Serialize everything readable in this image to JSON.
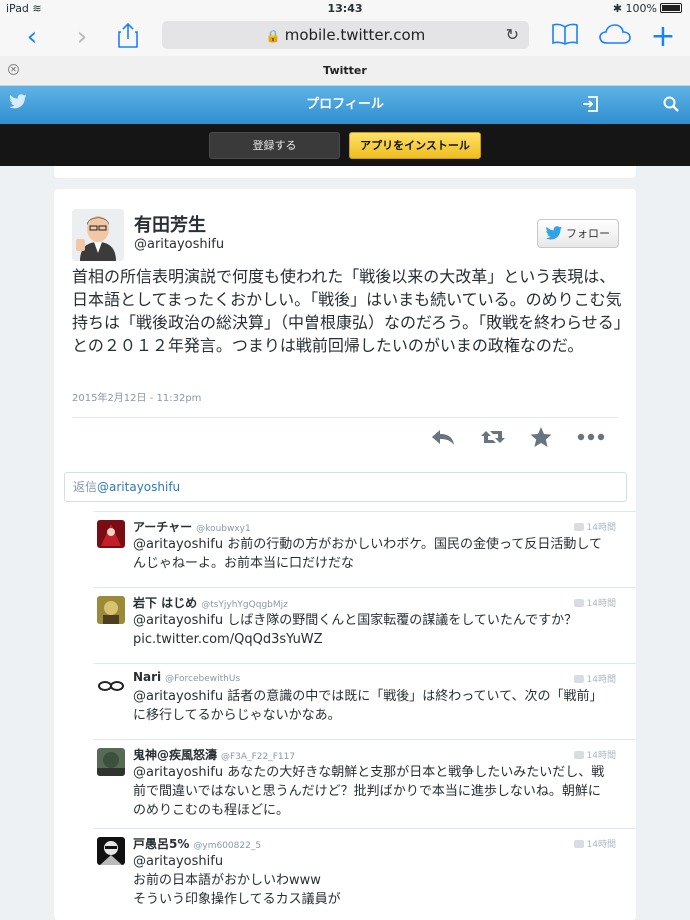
{
  "status_bar": {
    "device": "iPad",
    "time": "13:43",
    "battery": "100%"
  },
  "browser": {
    "url": "mobile.twitter.com",
    "tab_title": "Twitter"
  },
  "twitter_header": {
    "title": "プロフィール"
  },
  "action_bar": {
    "register": "登録する",
    "install": "アプリをインストール"
  },
  "tweet": {
    "name": "有田芳生",
    "handle": "@aritayoshifu",
    "follow": "フォロー",
    "text": "首相の所信表明演説で何度も使われた「戦後以来の大改革」という表現は、日本語としてまったくおかしい。「戦後」はいまも続いている。のめりこむ気持ちは「戦後政治の総決算」（中曽根康弘）なのだろう。「敗戦を終わらせる」との２０１２年発言。つまりは戦前回帰したいのがいまの政権なのだ。",
    "date": "2015年2月12日 - 11:32pm"
  },
  "reply_box": {
    "prefix": "返信",
    "mention": "@aritayoshifu"
  },
  "replies": [
    {
      "name": "アーチャー",
      "handle": "@koubwxy1",
      "time": "14時間",
      "text": "@aritayoshifu お前の行動の方がおかしいわボケ。国民の金使って反日活動してんじゃねーよ。お前本当に口だけだな"
    },
    {
      "name": "岩下 はじめ",
      "handle": "@tsYjyhYgQqgbMjz",
      "time": "14時間",
      "text": "@aritayoshifu しばき隊の野間くんと国家転覆の謀議をしていたんですか？pic.twitter.com/QqQd3sYuWZ"
    },
    {
      "name": "Nari",
      "handle": "@ForcebewithUs",
      "time": "14時間",
      "text": "@aritayoshifu 話者の意識の中では既に「戦後」は終わっていて、次の「戦前」に移行してるからじゃないかなあ。"
    },
    {
      "name": "鬼神@疾風怒濤",
      "handle": "@F3A_F22_F117",
      "time": "14時間",
      "text": "@aritayoshifu あなたの大好きな朝鮮と支那が日本と戦争したいみたいだし、戦前で間違いではないと思うんだけど？批判ばかりで本当に進歩しないね。朝鮮にのめりこむのも程ほどに。"
    },
    {
      "name": "戸愚呂5%",
      "handle": "@ym600822_5",
      "time": "14時間",
      "text_lines": [
        "@aritayoshifu",
        "お前の日本語がおかしいわwww",
        "そういう印象操作してるカス議員が"
      ]
    }
  ]
}
